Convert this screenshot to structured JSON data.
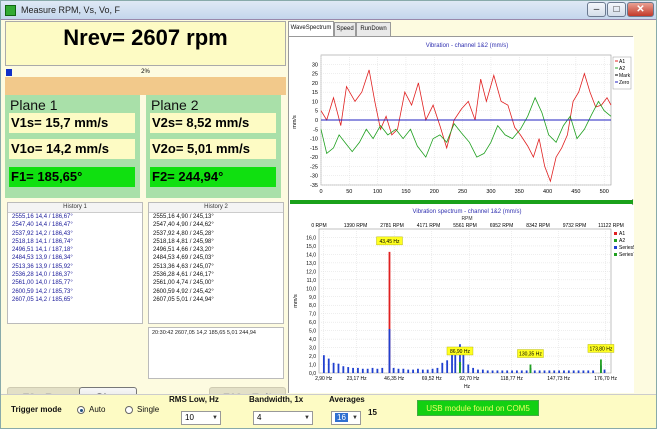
{
  "window": {
    "title": "Measure RPM, Vs, Vo, F"
  },
  "rpm": {
    "label": "Nrev= 2607 rpm",
    "progress_text": "2%",
    "progress": 0.02
  },
  "plane1": {
    "title": "Plane 1",
    "vs": "V1s= 15,7 mm/s",
    "vo": "V1o= 14,2 mm/s",
    "f": "F1= 185,65°"
  },
  "plane2": {
    "title": "Plane 2",
    "vs": "V2s= 8,52 mm/s",
    "vo": "V2o= 5,01 mm/s",
    "f": "F2= 244,94°"
  },
  "history1": {
    "header": "History 1",
    "rows": [
      "2555,16 14,4 / 186,67°",
      "2547,40 14,4 / 186,47°",
      "2537,92 14,2 / 186,43°",
      "2518,18 14,1 / 186,74°",
      "2496,51 14,1 / 187,18°",
      "2484,53 13,9 / 186,34°",
      "2513,36 13,9 / 185,92°",
      "2536,28 14,0 / 186,37°",
      "2561,00 14,0 / 185,77°",
      "2600,59 14,2 / 185,73°",
      "2607,05 14,2 / 185,65°"
    ]
  },
  "history2": {
    "header": "History 2",
    "rows": [
      "2555,16 4,90 / 245,13°",
      "2547,40 4,90 / 244,62°",
      "2537,92 4,80 / 245,28°",
      "2518,18 4,81 / 245,98°",
      "2496,51 4,66 / 243,20°",
      "2484,53 4,69 / 245,03°",
      "2513,36 4,63 / 245,07°",
      "2536,28 4,61 / 246,17°",
      "2561,00 4,74 / 245,00°",
      "2600,59 4,92 / 245,42°",
      "2607,05 5,01 / 244,94°"
    ]
  },
  "status_log": "20:30:42 2607,05 14,2 185,65 5,01 244,94",
  "buttons": {
    "run": "F9 - Run",
    "stop": "Stop",
    "exit": "F10 - Exit"
  },
  "tabs": [
    "WaveSpectrum",
    "Speed",
    "RunDown"
  ],
  "window_buttons": {
    "minimize": "–",
    "maximize": "□",
    "close": "✕"
  },
  "colors": {
    "plane_bg": "#a9e0a9",
    "value_bg": "#fdfbc4",
    "phase_bg": "#10e010",
    "a1": "#e02020",
    "a2": "#20a020",
    "mark": "#000000",
    "zero": "#2020c0",
    "usb_bg": "#12d012"
  },
  "chart_data": [
    {
      "type": "line",
      "title": "Vibration - channel 1&2 (mm/s)",
      "ylabel": "mm/s",
      "xlim": [
        0,
        512
      ],
      "ylim": [
        -35,
        35
      ],
      "xticks": [
        0,
        50,
        100,
        150,
        200,
        250,
        300,
        350,
        400,
        450,
        500
      ],
      "yticks": [
        30,
        25,
        20,
        15,
        10,
        5,
        0,
        -5,
        -10,
        -15,
        -20,
        -25,
        -30,
        -35
      ],
      "legend": [
        "A1",
        "A2",
        "Mark",
        "Zero"
      ],
      "legend_position": "top-right",
      "series": [
        {
          "name": "A1",
          "color": "#e02020",
          "points": [
            [
              0,
              5
            ],
            [
              10,
              0
            ],
            [
              22,
              12
            ],
            [
              35,
              -3
            ],
            [
              45,
              18
            ],
            [
              60,
              10
            ],
            [
              72,
              15
            ],
            [
              85,
              27
            ],
            [
              95,
              10
            ],
            [
              105,
              -5
            ],
            [
              115,
              2
            ],
            [
              125,
              -8
            ],
            [
              135,
              -5
            ],
            [
              148,
              15
            ],
            [
              160,
              8
            ],
            [
              172,
              20
            ],
            [
              185,
              0
            ],
            [
              198,
              8
            ],
            [
              210,
              -3
            ],
            [
              222,
              -15
            ],
            [
              235,
              0
            ],
            [
              248,
              6
            ],
            [
              260,
              10
            ],
            [
              272,
              0
            ],
            [
              282,
              22
            ],
            [
              292,
              10
            ],
            [
              305,
              24
            ],
            [
              318,
              10
            ],
            [
              330,
              8
            ],
            [
              342,
              -4
            ],
            [
              352,
              -8
            ],
            [
              365,
              -14
            ],
            [
              375,
              -20
            ],
            [
              385,
              -10
            ],
            [
              395,
              -25
            ],
            [
              405,
              -33
            ],
            [
              415,
              -20
            ],
            [
              425,
              -15
            ],
            [
              435,
              -8
            ],
            [
              445,
              10
            ],
            [
              455,
              15
            ],
            [
              465,
              25
            ],
            [
              475,
              15
            ],
            [
              485,
              7
            ],
            [
              495,
              8
            ],
            [
              505,
              12
            ],
            [
              512,
              8
            ]
          ]
        },
        {
          "name": "A2",
          "color": "#20a020",
          "points": [
            [
              0,
              -5
            ],
            [
              10,
              -18
            ],
            [
              22,
              -15
            ],
            [
              32,
              -8
            ],
            [
              42,
              -12
            ],
            [
              55,
              -17
            ],
            [
              68,
              -12
            ],
            [
              80,
              -5
            ],
            [
              92,
              -10
            ],
            [
              105,
              -3
            ],
            [
              118,
              -8
            ],
            [
              132,
              -5
            ],
            [
              145,
              -10
            ],
            [
              158,
              -5
            ],
            [
              170,
              -14
            ],
            [
              185,
              -20
            ],
            [
              198,
              -10
            ],
            [
              210,
              -8
            ],
            [
              222,
              -12
            ],
            [
              235,
              -2
            ],
            [
              248,
              -7
            ],
            [
              262,
              -12
            ],
            [
              275,
              -20
            ],
            [
              288,
              -18
            ],
            [
              300,
              -12
            ],
            [
              312,
              -3
            ],
            [
              325,
              -8
            ],
            [
              338,
              -10
            ],
            [
              352,
              -5
            ],
            [
              365,
              2
            ],
            [
              378,
              12
            ],
            [
              390,
              4
            ],
            [
              402,
              -8
            ],
            [
              415,
              -12
            ],
            [
              428,
              -3
            ],
            [
              440,
              2
            ],
            [
              452,
              -10
            ],
            [
              465,
              -5
            ],
            [
              478,
              3
            ],
            [
              490,
              10
            ],
            [
              500,
              5
            ],
            [
              512,
              2
            ]
          ]
        },
        {
          "name": "Zero",
          "color": "#2020c0",
          "points": [
            [
              0,
              0
            ],
            [
              512,
              0
            ]
          ]
        }
      ]
    },
    {
      "type": "bar",
      "title": "Vibration spectrum - channel 1&2 (mm/s)",
      "ylabel": "mm/s",
      "xlabel": "Hz",
      "top_axis_label": "RPM",
      "xlim": [
        0,
        180
      ],
      "ylim": [
        0,
        17
      ],
      "yticks": [
        16,
        15,
        14,
        13,
        12,
        11,
        10,
        9,
        8,
        7,
        6,
        5,
        4,
        3,
        2,
        1,
        0
      ],
      "xticks": [
        "2,90 Hz",
        "23,17 Hz",
        "46,35 Hz",
        "69,52 Hz",
        "92,70 Hz",
        "118,77 Hz",
        "147,73 Hz",
        "176,70 Hz"
      ],
      "xtick_values": [
        2.9,
        23.17,
        46.35,
        69.52,
        92.7,
        118.77,
        147.73,
        176.7
      ],
      "top_ticks": [
        "0 RPM",
        "1390 RPM",
        "2781 RPM",
        "4171 RPM",
        "5561 RPM",
        "6952 RPM",
        "8342 RPM",
        "9732 RPM",
        "11122 RPM"
      ],
      "legend": [
        "A1",
        "A2",
        "Series5",
        "Series7"
      ],
      "annotations": [
        {
          "text": "43,45 Hz",
          "x": 43.45,
          "y": 14.3
        },
        {
          "text": "86,90 Hz",
          "x": 86.9,
          "y": 1.3
        },
        {
          "text": "130,35 Hz",
          "x": 130.35,
          "y": 1.0
        },
        {
          "text": "173,80 Hz",
          "x": 173.8,
          "y": 1.6
        }
      ],
      "series": [
        {
          "name": "A1",
          "color": "#e02020",
          "bars": [
            [
              43.45,
              14.3
            ]
          ]
        },
        {
          "name": "A2",
          "color": "#2040d0",
          "bars": [
            [
              3,
              2.1
            ],
            [
              6,
              1.7
            ],
            [
              9,
              1.2
            ],
            [
              12,
              1.1
            ],
            [
              15,
              0.8
            ],
            [
              18,
              0.7
            ],
            [
              21,
              0.6
            ],
            [
              24,
              0.6
            ],
            [
              27,
              0.5
            ],
            [
              30,
              0.5
            ],
            [
              33,
              0.6
            ],
            [
              36,
              0.5
            ],
            [
              39,
              0.6
            ],
            [
              43.45,
              5.2
            ],
            [
              46,
              0.6
            ],
            [
              49,
              0.5
            ],
            [
              52,
              0.5
            ],
            [
              55,
              0.4
            ],
            [
              58,
              0.4
            ],
            [
              61,
              0.5
            ],
            [
              64,
              0.4
            ],
            [
              67,
              0.4
            ],
            [
              70,
              0.5
            ],
            [
              73,
              0.6
            ],
            [
              76,
              1.2
            ],
            [
              79,
              1.5
            ],
            [
              82,
              2.2
            ],
            [
              84,
              2.4
            ],
            [
              86.9,
              3.4
            ],
            [
              89,
              2.2
            ],
            [
              92,
              1.0
            ],
            [
              95,
              0.6
            ],
            [
              98,
              0.4
            ],
            [
              101,
              0.4
            ],
            [
              104,
              0.3
            ],
            [
              107,
              0.3
            ],
            [
              110,
              0.3
            ],
            [
              113,
              0.3
            ],
            [
              116,
              0.3
            ],
            [
              119,
              0.3
            ],
            [
              122,
              0.3
            ],
            [
              125,
              0.3
            ],
            [
              128,
              0.3
            ],
            [
              130.35,
              0.6
            ],
            [
              133,
              0.3
            ],
            [
              136,
              0.3
            ],
            [
              139,
              0.3
            ],
            [
              142,
              0.3
            ],
            [
              145,
              0.3
            ],
            [
              148,
              0.3
            ],
            [
              151,
              0.3
            ],
            [
              154,
              0.3
            ],
            [
              157,
              0.3
            ],
            [
              160,
              0.3
            ],
            [
              163,
              0.3
            ],
            [
              166,
              0.3
            ],
            [
              169,
              0.3
            ],
            [
              173.8,
              0.9
            ],
            [
              176,
              0.4
            ]
          ]
        },
        {
          "name": "Series7",
          "color": "#20a020",
          "bars": [
            [
              86.9,
              1.3
            ],
            [
              130.35,
              1.0
            ],
            [
              173.8,
              1.6
            ]
          ]
        }
      ]
    }
  ],
  "controls": {
    "trigger_label": "Trigger mode",
    "auto_label": "Auto",
    "single_label": "Single",
    "auto_selected": true,
    "rms_label": "RMS Low, Hz",
    "rms_value": "10",
    "bandwidth_label": "Bandwidth, 1x",
    "bandwidth_value": "4",
    "averages_label": "Averages",
    "averages_value": "16",
    "averages_count": "15",
    "usb_status": "USB module found on COM5"
  }
}
